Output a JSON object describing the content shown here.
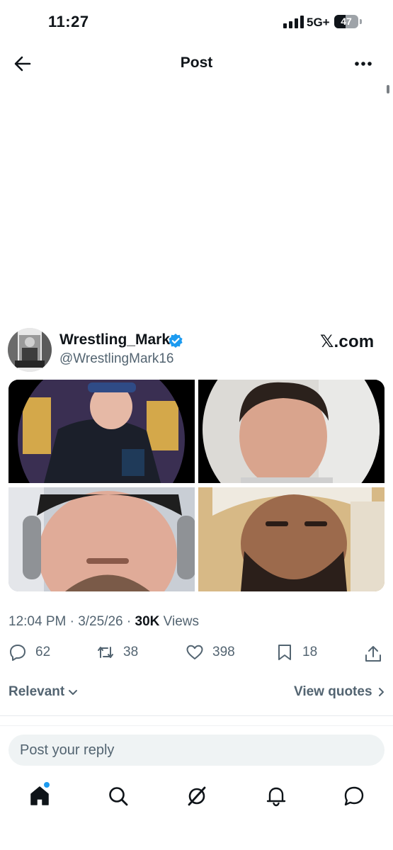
{
  "status_bar": {
    "time": "11:27",
    "network": "5G+",
    "battery": "47",
    "battery_level": 0.47
  },
  "header": {
    "title": "Post",
    "back_icon": "arrow-left-icon",
    "more_icon": "ellipsis-icon"
  },
  "post": {
    "display_name": "Wrestling_Mark",
    "handle": "@WrestlingMark16",
    "verified": true,
    "brand": "𝕏.com",
    "media": [
      "photo-1",
      "photo-2",
      "photo-3",
      "photo-4"
    ],
    "meta_prefix": "12:04 PM · 3/25/26 · ",
    "views_count": "30K",
    "views_label": " Views",
    "replies": "62",
    "reposts": "38",
    "likes": "398",
    "bookmarks": "18"
  },
  "filters": {
    "sort_label": "Relevant",
    "quotes_label": "View quotes"
  },
  "reply_box": {
    "placeholder": "Post your reply"
  },
  "tab_bar": [
    "home-icon",
    "search-icon",
    "grok-icon",
    "notifications-icon",
    "messages-icon"
  ],
  "colors": {
    "accent": "#1d9bf0",
    "text": "#0f1419",
    "muted": "#536471"
  }
}
